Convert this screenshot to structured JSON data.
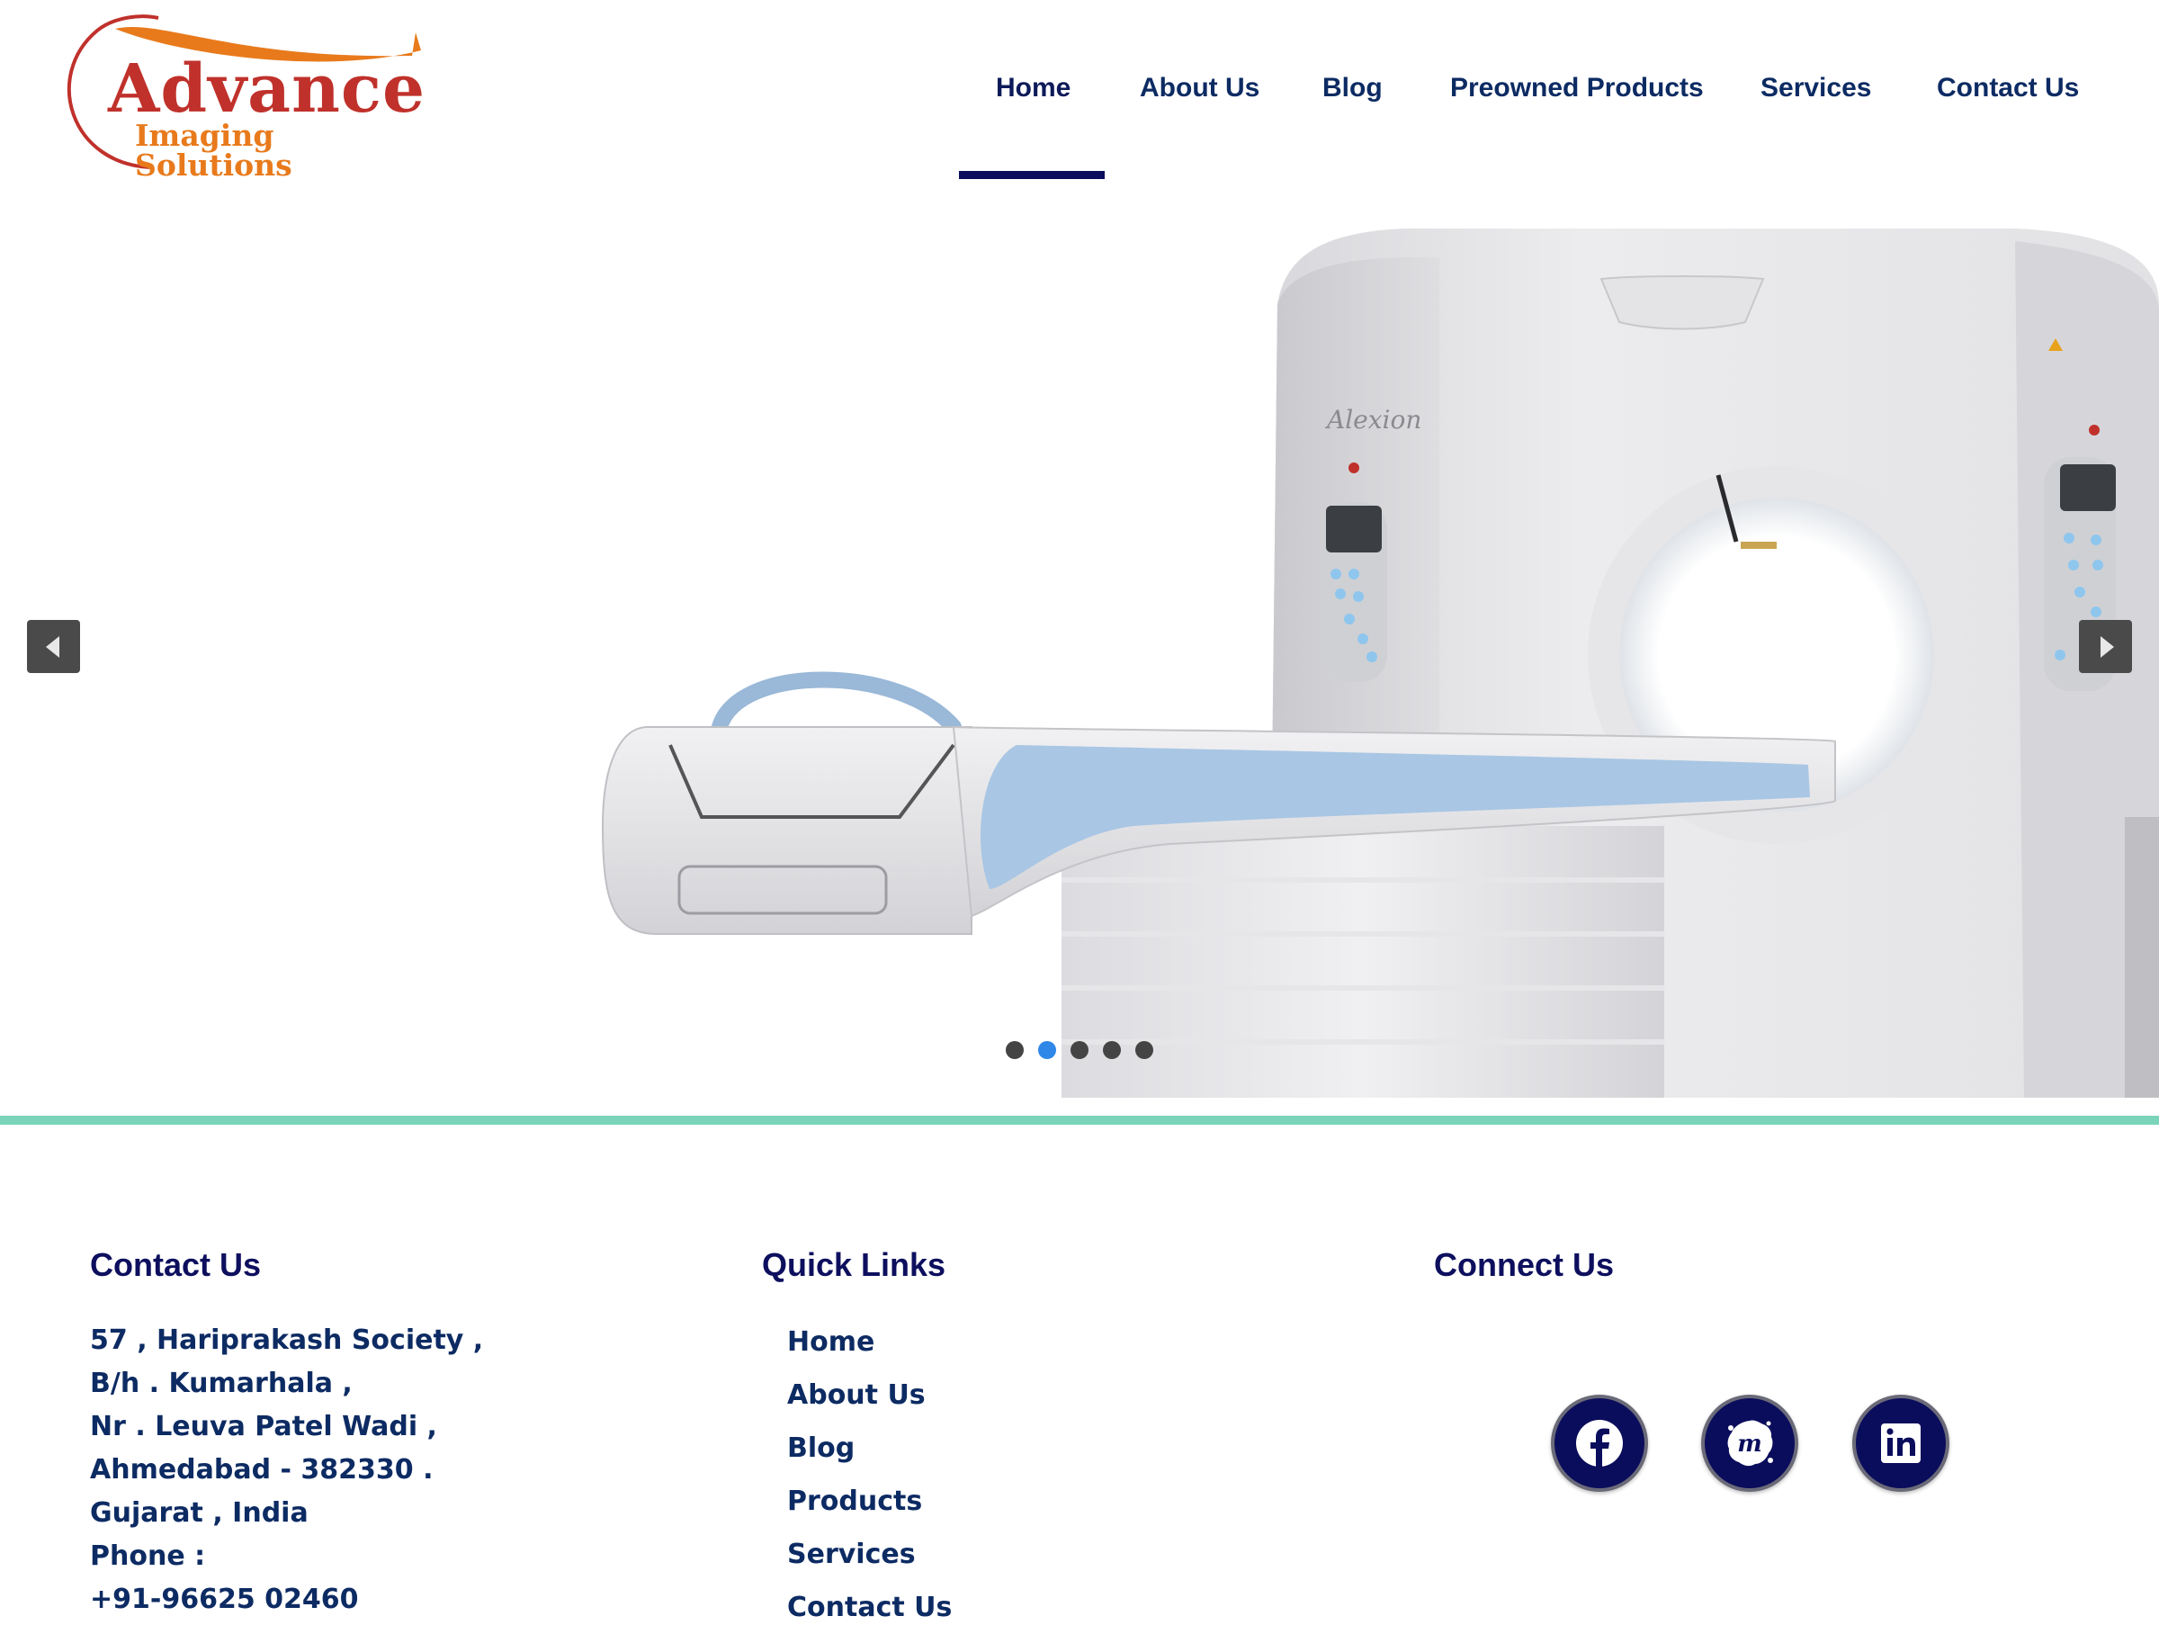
{
  "brand": {
    "name": "Advance",
    "tagline": "Imaging Solutions",
    "colors": {
      "primary": "#c0312b",
      "accent": "#e87a1c",
      "nav": "#0d2b63",
      "underline": "#0b0e5c",
      "divider": "#79d4b9"
    }
  },
  "nav": {
    "items": [
      "Home",
      "About Us",
      "Blog",
      "Preowned Products",
      "Services",
      "Contact Us"
    ],
    "active": "Home"
  },
  "hero": {
    "machine_label": "Alexion",
    "prev_icon": "chevron-left-icon",
    "next_icon": "chevron-right-icon",
    "slides_count": 5,
    "active_slide": 2,
    "dot_active_color": "#2f87e8"
  },
  "footer": {
    "contact": {
      "heading": "Contact Us",
      "lines": [
        "57 , Hariprakash Society ,",
        "B/h . Kumarhala ,",
        "Nr . Leuva Patel Wadi  ,",
        "Ahmedabad - 382330 .",
        "Gujarat , India",
        "Phone  :",
        "+91-96625 02460"
      ]
    },
    "quick_links": {
      "heading": "Quick Links",
      "items": [
        "Home",
        "About Us",
        "Blog",
        "Products",
        "Services",
        "Contact Us"
      ]
    },
    "connect": {
      "heading": "Connect Us",
      "icons": [
        "facebook-icon",
        "meetup-icon",
        "linkedin-icon"
      ]
    }
  }
}
